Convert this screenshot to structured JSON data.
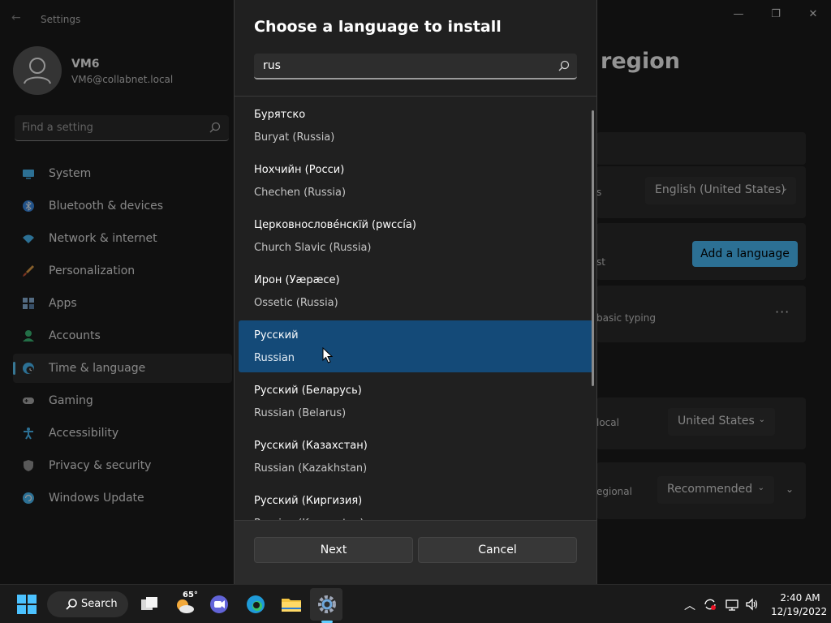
{
  "window": {
    "app_title": "Settings",
    "page_title_fragment": "region",
    "minimize_glyph": "—",
    "maximize_glyph": "❐",
    "close_glyph": "✕",
    "back_glyph": "←"
  },
  "user": {
    "name": "VM6",
    "email": "VM6@collabnet.local"
  },
  "sidebar": {
    "search_placeholder": "Find a setting",
    "items": [
      {
        "label": "System",
        "icon": "monitor-icon",
        "color": "#4cc2ff"
      },
      {
        "label": "Bluetooth & devices",
        "icon": "bluetooth-icon",
        "color": "#3b8eea"
      },
      {
        "label": "Network & internet",
        "icon": "wifi-icon",
        "color": "#4cc2ff"
      },
      {
        "label": "Personalization",
        "icon": "brush-icon",
        "color": "#e8a44a"
      },
      {
        "label": "Apps",
        "icon": "apps-icon",
        "color": "#8fb8e0"
      },
      {
        "label": "Accounts",
        "icon": "person-icon",
        "color": "#3dbf7a"
      },
      {
        "label": "Time & language",
        "icon": "globe-clock-icon",
        "color": "#4cc2ff"
      },
      {
        "label": "Gaming",
        "icon": "gamepad-icon",
        "color": "#b0b0b0"
      },
      {
        "label": "Accessibility",
        "icon": "accessibility-icon",
        "color": "#4cc2ff"
      },
      {
        "label": "Privacy & security",
        "icon": "shield-icon",
        "color": "#9a9a9a"
      },
      {
        "label": "Windows Update",
        "icon": "update-icon",
        "color": "#4cc2ff"
      }
    ],
    "active_index": 6
  },
  "background": {
    "row1_label_fragment": "s",
    "windows_display_language": "English (United States)",
    "row2_label_fragment": "st",
    "add_language_label": "Add a language",
    "row3_label_fragment": "basic typing",
    "more_glyph": "···",
    "row4_label_fragment": "local",
    "country_value": "United States",
    "row5_label_fragment": "egional",
    "format_value": "Recommended"
  },
  "dialog": {
    "title": "Choose a language to install",
    "search_value": "rus",
    "languages": [
      {
        "native": "Бурятско",
        "english": "Buryat (Russia)"
      },
      {
        "native": "Нохчийн (Росси)",
        "english": "Chechen (Russia)"
      },
      {
        "native": "Церковнослове́нскїй (рwссі́а)",
        "english": "Church Slavic (Russia)"
      },
      {
        "native": "Ирон (Уæрæсе)",
        "english": "Ossetic (Russia)"
      },
      {
        "native": "Русский",
        "english": "Russian"
      },
      {
        "native": "Русский (Беларусь)",
        "english": "Russian (Belarus)"
      },
      {
        "native": "Русский (Казахстан)",
        "english": "Russian (Kazakhstan)"
      },
      {
        "native": "Русский (Киргизия)",
        "english": "Russian (Kyrgyzstan)"
      }
    ],
    "selected_index": 4,
    "next_label": "Next",
    "cancel_label": "Cancel"
  },
  "taskbar": {
    "search_label": "Search",
    "weather_temp": "65°",
    "time": "2:40 AM",
    "date": "12/19/2022"
  },
  "colors": {
    "accent": "#60cdff",
    "selected_row": "#144a78",
    "add_button": "#4cc2ff"
  }
}
